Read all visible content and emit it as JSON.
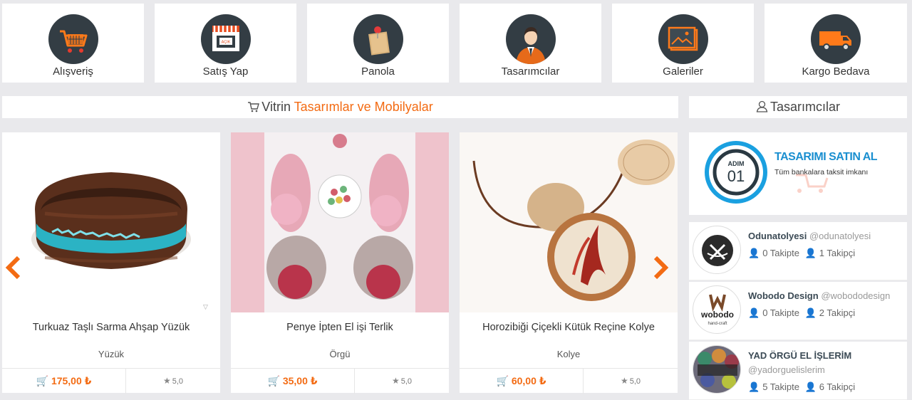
{
  "categories": [
    {
      "label": "Alışveriş",
      "icon": "shopping-cart-icon"
    },
    {
      "label": "Satış Yap",
      "icon": "shop-storefront-icon",
      "badge": "AÇIK"
    },
    {
      "label": "Panola",
      "icon": "pinboard-icon"
    },
    {
      "label": "Tasarımcılar",
      "icon": "designer-person-icon"
    },
    {
      "label": "Galeriler",
      "icon": "gallery-icon"
    },
    {
      "label": "Kargo Bedava",
      "icon": "delivery-truck-icon"
    }
  ],
  "showcase_header": {
    "prefix": "Vitrin",
    "accent": "Tasarımlar ve Mobilyalar"
  },
  "designers_header": {
    "label": "Tasarımcılar"
  },
  "products": [
    {
      "title": "Turkuaz Taşlı Sarma Ahşap Yüzük",
      "category": "Yüzük",
      "price": "175,00 ₺",
      "rating": "5,0"
    },
    {
      "title": "Penye İpten El işi Terlik",
      "category": "Örgü",
      "price": "35,00 ₺",
      "rating": "5,0"
    },
    {
      "title": "Horozibiği Çiçekli Kütük Reçine Kolye",
      "category": "Kolye",
      "price": "60,00 ₺",
      "rating": "5,0"
    }
  ],
  "promo": {
    "step_label": "ADIM",
    "step_number": "01",
    "title": "TASARIMI SATIN AL",
    "subtitle": "Tüm bankalara taksit imkanı"
  },
  "designers": [
    {
      "name": "Odunatolyesi",
      "handle": "@odunatolyesi",
      "following": "0 Takipte",
      "followers": "1 Takipçi"
    },
    {
      "name": "Wobodo Design",
      "handle": "@wobododesign",
      "following": "0 Takipte",
      "followers": "2 Takipçi",
      "logo_text": "wobodo",
      "logo_sub": "hand-craft"
    },
    {
      "name": "YAD ÖRGÜ EL İŞLERİM",
      "handle": "@yadorguelislerim",
      "following": "5 Takipte",
      "followers": "6 Takipçi"
    }
  ],
  "colors": {
    "accent": "#f36b13",
    "icon_bg": "#333d44",
    "promo_blue": "#1aa0e0"
  }
}
